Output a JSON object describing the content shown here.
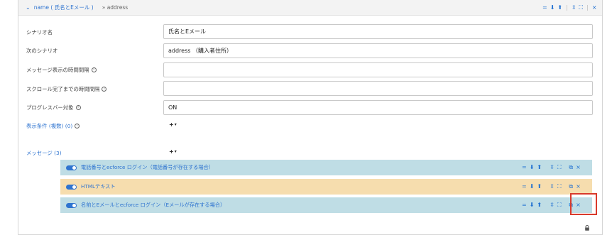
{
  "header": {
    "collapse_icon": "chevron-down-icon",
    "scenario_name": "name ( 氏名とEメール )",
    "next_scenario": "» address",
    "tools": {
      "menu": "=",
      "move_down": "⬇",
      "move_up": "⬆",
      "separator": "|",
      "collapse_all": "⇳",
      "expand_all": "⛶",
      "close": "×"
    }
  },
  "form": {
    "scenario_label": "シナリオ名",
    "scenario_value": "氏名とEメール",
    "next_label": "次のシナリオ",
    "next_value": "address （購入者住所）",
    "interval_label": "メッセージ表示の時間間隔",
    "interval_value": "",
    "scroll_label": "スクロール完了までの時間間隔",
    "scroll_value": "",
    "progress_label": "プログレスバー対象",
    "progress_value": "ON",
    "conditions_label": "表示条件 (複数) (0)",
    "add_symbol": "+",
    "caret": "▾",
    "info_symbol": "i"
  },
  "messages": {
    "label": "メッセージ (3)",
    "add_symbol": "+",
    "caret": "▾",
    "items": [
      {
        "title": "電話番号とecforce ログイン（電話番号が存在する場合）",
        "enabled": true,
        "color": "#bfdde5"
      },
      {
        "title": "HTMLテキスト",
        "enabled": true,
        "color": "#f6ddae"
      },
      {
        "title": "名前とEメールとecforce ログイン（Eメールが存在する場合）",
        "enabled": true,
        "color": "#bfdde5"
      }
    ],
    "row_tools": {
      "menu": "=",
      "move_down": "⬇",
      "move_up": "⬆",
      "collapse": "⇳",
      "expand": "⛶",
      "copy": "⧉",
      "delete": "×"
    }
  },
  "colors": {
    "accent": "#2f74d0",
    "highlight": "#d93a2b",
    "teal_row": "#bfdde5",
    "beige_row": "#f6ddae"
  }
}
